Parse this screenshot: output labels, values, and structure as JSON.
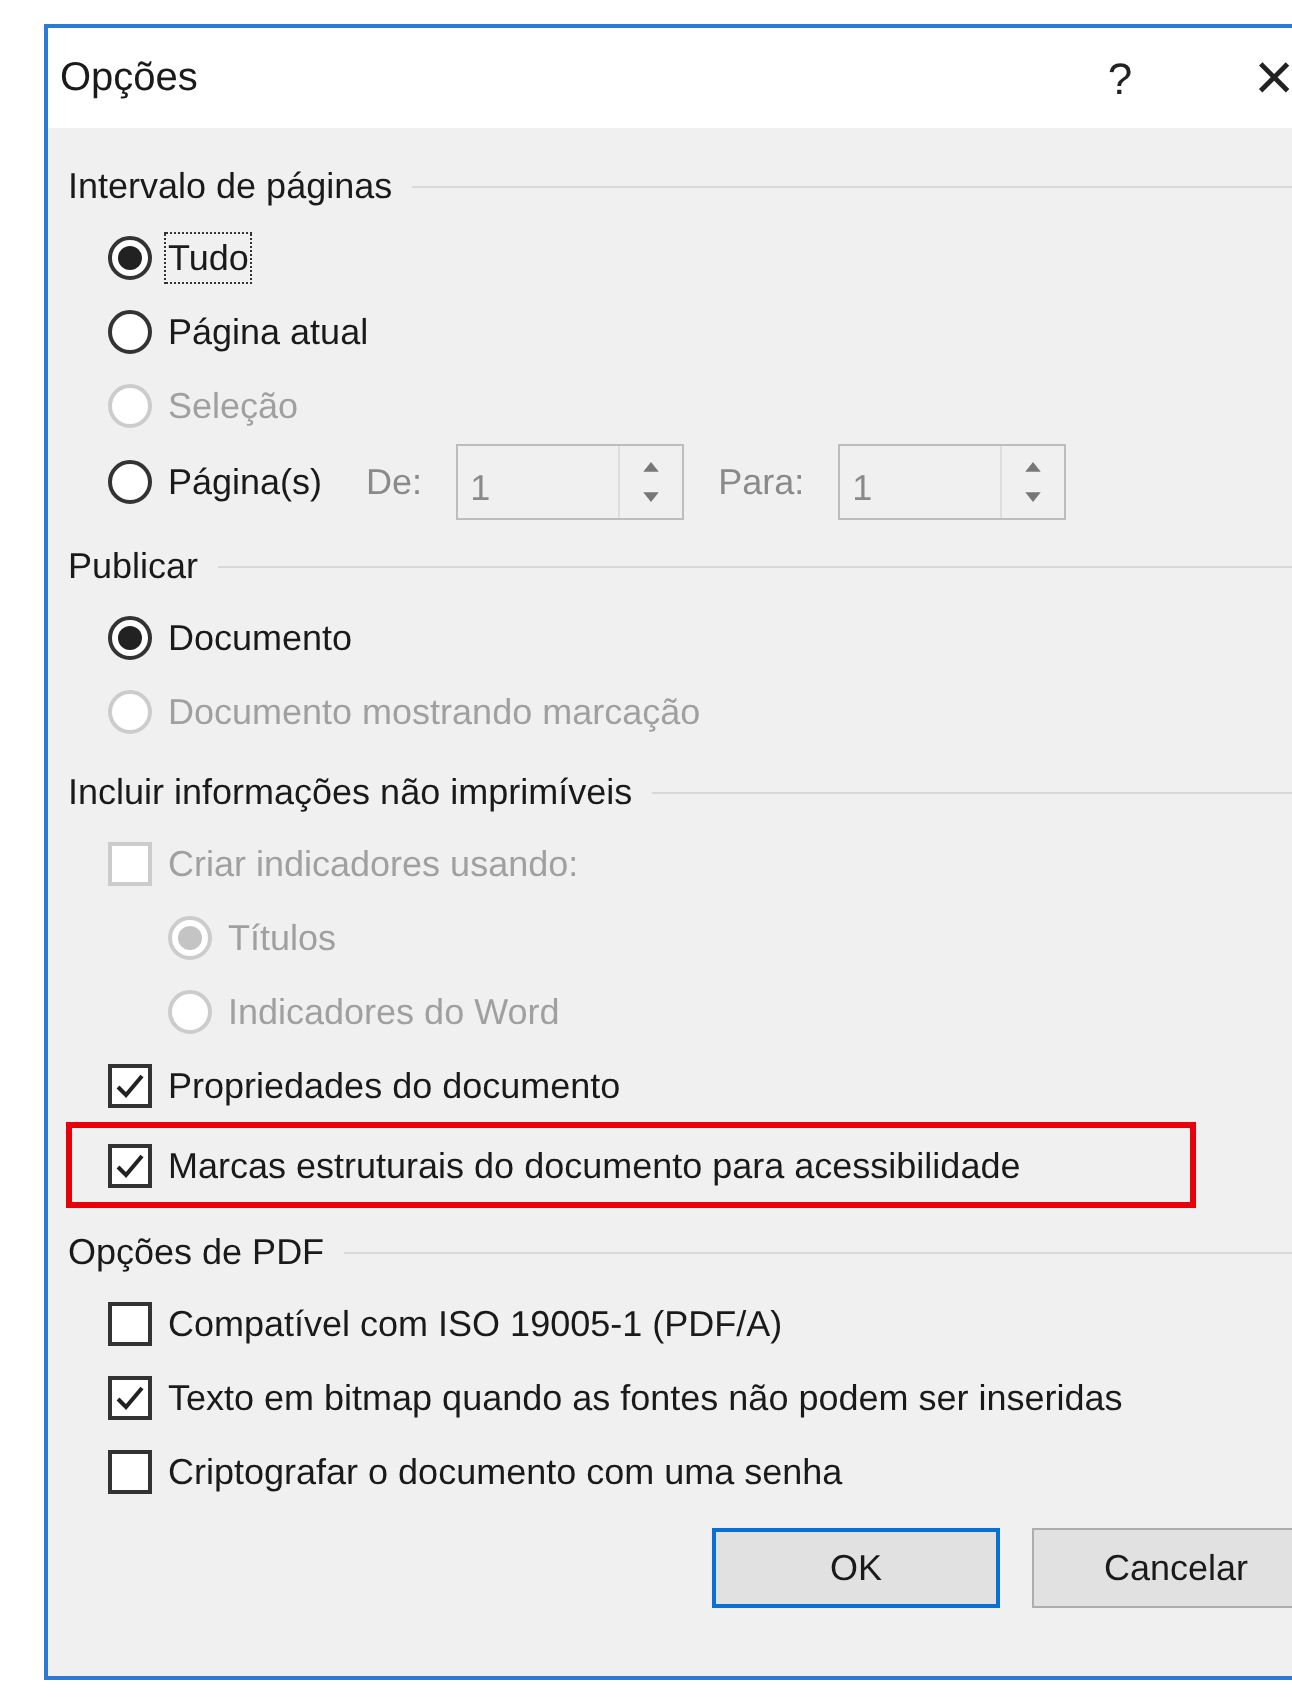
{
  "window": {
    "title": "Opções",
    "help": "?",
    "close": "×"
  },
  "sections": [
    {
      "title": "Intervalo de páginas",
      "items": [
        {
          "kind": "radio",
          "label": "Tudo",
          "selected": true,
          "disabled": false,
          "focused": true
        },
        {
          "kind": "radio",
          "label": "Página atual",
          "selected": false,
          "disabled": false
        },
        {
          "kind": "radio",
          "label": "Seleção",
          "selected": false,
          "disabled": true
        },
        {
          "kind": "range",
          "label": "Página(s)",
          "selected": false,
          "disabled": false,
          "from_label": "De:",
          "from_value": "1",
          "to_label": "Para:",
          "to_value": "1",
          "fields_disabled": true
        }
      ]
    },
    {
      "title": "Publicar",
      "items": [
        {
          "kind": "radio",
          "label": "Documento",
          "selected": true,
          "disabled": false
        },
        {
          "kind": "radio",
          "label": "Documento mostrando marcação",
          "selected": false,
          "disabled": true
        }
      ]
    },
    {
      "title": "Incluir informações não imprimíveis",
      "items": [
        {
          "kind": "checkbox",
          "label": "Criar indicadores usando:",
          "checked": false,
          "disabled": true,
          "children": [
            {
              "kind": "radio",
              "label": "Títulos",
              "selected": true,
              "disabled": true
            },
            {
              "kind": "radio",
              "label": "Indicadores do Word",
              "selected": false,
              "disabled": true
            }
          ]
        },
        {
          "kind": "checkbox",
          "label": "Propriedades do documento",
          "checked": true,
          "disabled": false
        },
        {
          "kind": "checkbox",
          "label": "Marcas estruturais do documento para acessibilidade",
          "checked": true,
          "disabled": false,
          "highlighted": true
        }
      ]
    },
    {
      "title": "Opções de PDF",
      "items": [
        {
          "kind": "checkbox",
          "label": "Compatível com ISO 19005-1 (PDF/A)",
          "checked": false,
          "disabled": false
        },
        {
          "kind": "checkbox",
          "label": "Texto em bitmap quando as fontes não podem ser inseridas",
          "checked": true,
          "disabled": false
        },
        {
          "kind": "checkbox",
          "label": "Criptografar o documento com uma senha",
          "checked": false,
          "disabled": false
        }
      ]
    }
  ],
  "buttons": [
    {
      "label": "OK",
      "default": true
    },
    {
      "label": "Cancelar",
      "default": false
    }
  ]
}
